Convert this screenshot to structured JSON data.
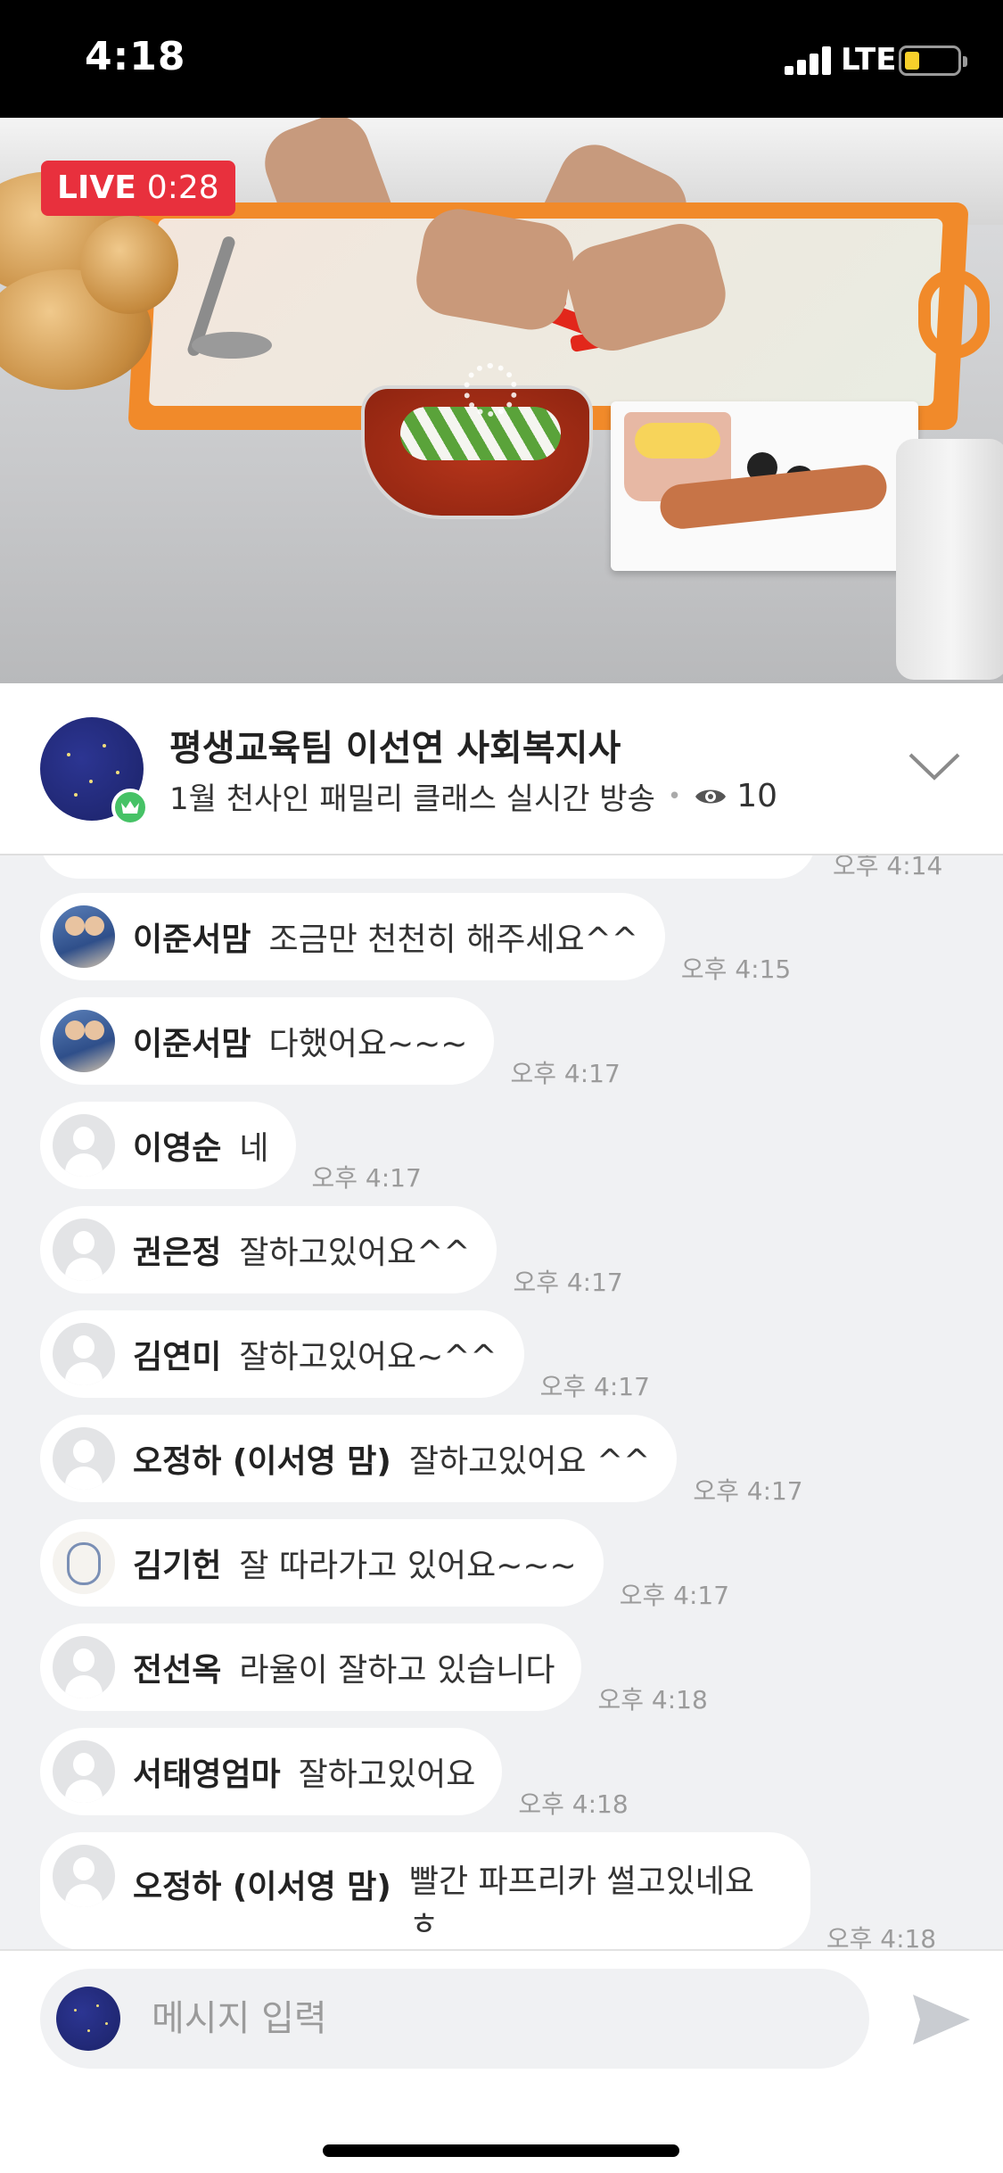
{
  "status_bar": {
    "time": "4:18",
    "network": "LTE",
    "battery_color": "#f7d02b"
  },
  "video": {
    "live_label": "LIVE",
    "elapsed": "0:28",
    "live_color": "#e8303d"
  },
  "broadcast": {
    "title": "평생교육팀 이선연 사회복지사",
    "subtitle": "1월 천사인 패밀리 클래스 실시간 방송",
    "viewers": "10",
    "host_badge_color": "#46c266"
  },
  "chat": {
    "partial_time": "오후 4:14",
    "messages": [
      {
        "name": "이준서맘",
        "text": "조금만  천천히  해주세요^^",
        "time": "오후 4:15",
        "avatar": "kids"
      },
      {
        "name": "이준서맘",
        "text": "다했어요~~~",
        "time": "오후 4:17",
        "avatar": "kids"
      },
      {
        "name": "이영순",
        "text": "네",
        "time": "오후 4:17",
        "avatar": "default"
      },
      {
        "name": "권은정",
        "text": "잘하고있어요^^",
        "time": "오후 4:17",
        "avatar": "default"
      },
      {
        "name": "김연미",
        "text": "잘하고있어요~^^",
        "time": "오후 4:17",
        "avatar": "default"
      },
      {
        "name": "오정하 (이서영 맘)",
        "text": "잘하고있어요 ^^",
        "time": "오후 4:17",
        "avatar": "default"
      },
      {
        "name": "김기헌",
        "text": "잘 따라가고 있어요~~~",
        "time": "오후 4:17",
        "avatar": "drawing"
      },
      {
        "name": "전선옥",
        "text": "라율이 잘하고 있습니다",
        "time": "오후 4:18",
        "avatar": "default"
      },
      {
        "name": "서태영엄마",
        "text": "잘하고있어요",
        "time": "오후 4:18",
        "avatar": "default"
      },
      {
        "name": "오정하 (이서영 맘)",
        "text": "빨간 파프리카 썰고있네요 ㅎ",
        "time": "오후 4:18",
        "avatar": "default"
      }
    ]
  },
  "input": {
    "placeholder": "메시지 입력",
    "value": ""
  }
}
